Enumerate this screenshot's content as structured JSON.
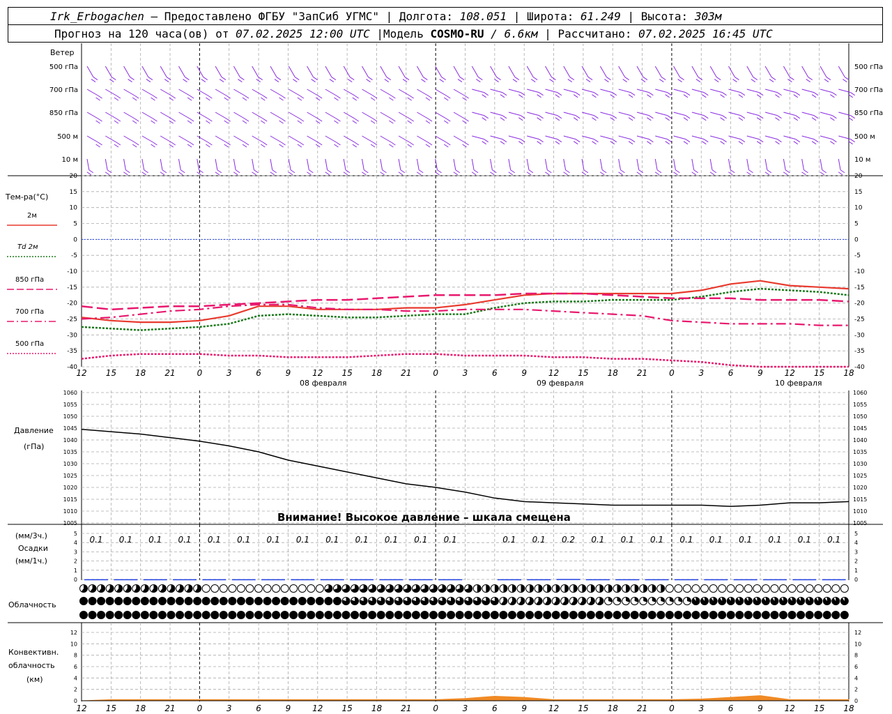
{
  "header": {
    "station": "Irk_Erbogachen",
    "provider": "– Предоставлено ФГБУ \"ЗапСиб УГМС\"",
    "lon_label": "Долгота:",
    "lon": "108.051",
    "lat_label": "Широта:",
    "lat": "61.249",
    "alt_label": "Высота:",
    "alt": "303м",
    "forecast_prefix": "Прогноз на 120 часа(ов) от",
    "forecast_start": "07.02.2025 12:00 UTC",
    "model_label": "|Модель",
    "model": "COSMO-RU",
    "model_res": "/ 6.6км",
    "calc_label": "| Рассчитано:",
    "calc_time": "07.02.2025 16:45 UTC"
  },
  "time_axis": {
    "hours": [
      "12",
      "15",
      "18",
      "21",
      "0",
      "3",
      "6",
      "9",
      "12",
      "15",
      "18",
      "21",
      "0",
      "3",
      "6",
      "9",
      "12",
      "15",
      "18",
      "21",
      "0",
      "3",
      "6",
      "9",
      "12",
      "15",
      "18"
    ],
    "dates": [
      "08 февраля",
      "09 февраля",
      "10 февраля"
    ]
  },
  "wind": {
    "title": "Ветер",
    "levels": [
      "500 гПа",
      "700 гПа",
      "850 гПа",
      "500 м",
      "10 м"
    ],
    "color": "#8a2be2"
  },
  "temperature": {
    "title": "Тем-ра(°C)",
    "legend": [
      {
        "label": "2м",
        "color": "#e83a2e"
      },
      {
        "label": "Td 2м",
        "color": "#1a7a1a"
      },
      {
        "label": "850 гПа",
        "color": "#e8186e"
      },
      {
        "label": "700 гПа",
        "color": "#e8186e"
      },
      {
        "label": "500 гПа",
        "color": "#e8186e"
      }
    ],
    "ticks": [
      "20",
      "15",
      "10",
      "5",
      "0",
      "-5",
      "-10",
      "-15",
      "-20",
      "-25",
      "-30",
      "-35",
      "-40"
    ]
  },
  "pressure": {
    "title": "Давление",
    "unit": "(гПа)",
    "ticks": [
      "1060",
      "1055",
      "1050",
      "1045",
      "1040",
      "1035",
      "1030",
      "1025",
      "1020",
      "1015",
      "1010",
      "1005"
    ],
    "warning": "Внимание! Высокое давление – шкала смещена"
  },
  "precip": {
    "unit3": "(мм/3ч.)",
    "title": "Осадки",
    "unit1": "(мм/1ч.)",
    "ticks": [
      "5",
      "4",
      "3",
      "2",
      "1",
      "0"
    ],
    "labels": [
      "0.1",
      "0.1",
      "0.1",
      "0.1",
      "0.1",
      "0.1",
      "0.1",
      "0.1",
      "0.1",
      "0.1",
      "0.1",
      "0.1",
      "0.1",
      "",
      "0.1",
      "0.1",
      "0.2",
      "0.1",
      "0.1",
      "0.1",
      "0.1",
      "0.1",
      "0.1",
      "0.1",
      "0.1",
      "0.1"
    ]
  },
  "cloud": {
    "title": "Облачность"
  },
  "convective": {
    "title1": "Конвективн.",
    "title2": "облачность",
    "unit": "(км)",
    "ticks": [
      "12",
      "10",
      "8",
      "6",
      "4",
      "2",
      "0"
    ]
  },
  "chart_data": [
    {
      "type": "line",
      "title": "Тем-ра(°C)",
      "x": [
        "07.02 12",
        "07.02 15",
        "07.02 18",
        "07.02 21",
        "08.02 00",
        "08.02 03",
        "08.02 06",
        "08.02 09",
        "08.02 12",
        "08.02 15",
        "08.02 18",
        "08.02 21",
        "09.02 00",
        "09.02 03",
        "09.02 06",
        "09.02 09",
        "09.02 12",
        "09.02 15",
        "09.02 18",
        "09.02 21",
        "10.02 00",
        "10.02 03",
        "10.02 06",
        "10.02 09",
        "10.02 12",
        "10.02 15",
        "10.02 18"
      ],
      "ylim": [
        -40,
        20
      ],
      "series": [
        {
          "name": "2м",
          "values": [
            -24.5,
            -25.5,
            -26,
            -26,
            -25.5,
            -24,
            -21,
            -21,
            -22,
            -22,
            -22,
            -21.5,
            -21.5,
            -20.5,
            -19,
            -17.5,
            -17,
            -17,
            -17,
            -17,
            -17,
            -16,
            -14,
            -13,
            -14.5,
            -15,
            -15.5
          ]
        },
        {
          "name": "Td 2м",
          "values": [
            -27.5,
            -28,
            -28.5,
            -28,
            -27.5,
            -26.5,
            -24,
            -23.5,
            -24,
            -24.5,
            -24.5,
            -24,
            -23.5,
            -23.5,
            -21.5,
            -20,
            -19.5,
            -19.5,
            -19,
            -19,
            -19,
            -18,
            -16.5,
            -15.5,
            -16,
            -16.5,
            -17.5
          ]
        },
        {
          "name": "850 гПа",
          "values": [
            -21,
            -22,
            -21.5,
            -21,
            -21,
            -20.5,
            -20,
            -19.5,
            -19,
            -19,
            -18.5,
            -18,
            -17.5,
            -17.5,
            -17.5,
            -17,
            -17,
            -17,
            -17.5,
            -18,
            -18.5,
            -18.5,
            -18.5,
            -19,
            -19,
            -19,
            -19.5
          ]
        },
        {
          "name": "700 гПа",
          "values": [
            -25,
            -24.5,
            -23.5,
            -22.5,
            -22,
            -21,
            -20.5,
            -20.5,
            -21.5,
            -22,
            -22,
            -22.5,
            -22.5,
            -22,
            -22,
            -22,
            -22.5,
            -23,
            -23.5,
            -24,
            -25.5,
            -26,
            -26.5,
            -26.5,
            -26.5,
            -27,
            -27
          ]
        },
        {
          "name": "500 гПа",
          "values": [
            -37.5,
            -36.5,
            -36,
            -36,
            -36,
            -36.5,
            -36.5,
            -37,
            -37,
            -37,
            -36.5,
            -36,
            -36,
            -36.5,
            -36.5,
            -36.5,
            -37,
            -37,
            -37.5,
            -37.5,
            -38,
            -38.5,
            -39.5,
            -41,
            -42,
            -43,
            -44
          ]
        }
      ]
    },
    {
      "type": "line",
      "title": "Давление",
      "x": [
        "07.02 12",
        "07.02 15",
        "07.02 18",
        "07.02 21",
        "08.02 00",
        "08.02 03",
        "08.02 06",
        "08.02 09",
        "08.02 12",
        "08.02 15",
        "08.02 18",
        "08.02 21",
        "09.02 00",
        "09.02 03",
        "09.02 06",
        "09.02 09",
        "09.02 12",
        "09.02 15",
        "09.02 18",
        "09.02 21",
        "10.02 00",
        "10.02 03",
        "10.02 06",
        "10.02 09",
        "10.02 12",
        "10.02 15",
        "10.02 18"
      ],
      "ylim": [
        1005,
        1060
      ],
      "series": [
        {
          "name": "Давление",
          "values": [
            1044.5,
            1043.5,
            1042.5,
            1041,
            1039.5,
            1037.5,
            1035,
            1031.5,
            1029,
            1026.5,
            1024,
            1021.5,
            1020,
            1018,
            1015.5,
            1014,
            1013.5,
            1013,
            1012.5,
            1012.5,
            1012.5,
            1012.5,
            1012,
            1012.5,
            1013.5,
            1013.5,
            1014
          ]
        }
      ]
    },
    {
      "type": "bar",
      "title": "Осадки",
      "x": [
        "07.02 12",
        "07.02 15",
        "07.02 18",
        "07.02 21",
        "08.02 00",
        "08.02 03",
        "08.02 06",
        "08.02 09",
        "08.02 12",
        "08.02 15",
        "08.02 18",
        "08.02 21",
        "09.02 00",
        "09.02 03",
        "09.02 06",
        "09.02 09",
        "09.02 12",
        "09.02 15",
        "09.02 18",
        "09.02 21",
        "10.02 00",
        "10.02 03",
        "10.02 06",
        "10.02 09",
        "10.02 12",
        "10.02 15"
      ],
      "ylim": [
        0,
        5
      ],
      "series": [
        {
          "name": "мм/3ч.",
          "values": [
            0.1,
            0.1,
            0.1,
            0.1,
            0.1,
            0.1,
            0.1,
            0.1,
            0.1,
            0.1,
            0.1,
            0.1,
            0.1,
            0,
            0.1,
            0.1,
            0.2,
            0.1,
            0.1,
            0.1,
            0.1,
            0.1,
            0.1,
            0.1,
            0.1,
            0.1
          ]
        }
      ]
    },
    {
      "type": "area",
      "title": "Конвективн. облачность",
      "x": [
        "07.02 12",
        "07.02 15",
        "07.02 18",
        "07.02 21",
        "08.02 00",
        "08.02 03",
        "08.02 06",
        "08.02 09",
        "08.02 12",
        "08.02 15",
        "08.02 18",
        "08.02 21",
        "09.02 00",
        "09.02 03",
        "09.02 06",
        "09.02 09",
        "09.02 12",
        "09.02 15",
        "09.02 18",
        "09.02 21",
        "10.02 00",
        "10.02 03",
        "10.02 06",
        "10.02 09",
        "10.02 12",
        "10.02 15",
        "10.02 18"
      ],
      "ylim": [
        0,
        13
      ],
      "series": [
        {
          "name": "км",
          "values": [
            0,
            0.2,
            0.2,
            0.2,
            0.2,
            0.2,
            0.2,
            0.2,
            0.2,
            0.2,
            0.2,
            0.2,
            0.2,
            0.4,
            0.8,
            0.6,
            0.2,
            0.2,
            0.2,
            0.2,
            0.2,
            0.3,
            0.6,
            0.9,
            0.2,
            0.2,
            0.2
          ]
        }
      ]
    }
  ]
}
